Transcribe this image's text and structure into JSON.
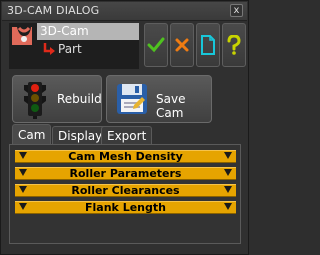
{
  "window": {
    "title": "3D-CAM DIALOG",
    "close_glyph": "x"
  },
  "tree": {
    "items": [
      {
        "label": "3D-Cam",
        "selected": true,
        "icon": "cam-profile-icon"
      },
      {
        "label": "Part",
        "selected": false,
        "icon": "red-arrow-icon"
      }
    ]
  },
  "top_buttons": [
    {
      "name": "accept-button",
      "icon": "green-check-icon",
      "color": "#4fc21f"
    },
    {
      "name": "cancel-button",
      "icon": "orange-x-icon",
      "color": "#f07c12"
    },
    {
      "name": "new-document-button",
      "icon": "new-document-icon",
      "color": "#18c7d9"
    },
    {
      "name": "help-button",
      "icon": "question-mark-icon",
      "color": "#c8d400"
    }
  ],
  "actions": {
    "rebuild_label": "Rebuild",
    "rebuild_icon": "traffic-light-icon",
    "save_label": "Save Cam",
    "save_icon": "floppy-disk-icon"
  },
  "tabs": [
    {
      "label": "Cam",
      "active": true
    },
    {
      "label": "Display",
      "active": false
    },
    {
      "label": "Export",
      "active": false
    }
  ],
  "sections": [
    {
      "title": "Cam Mesh Density",
      "expanded": false
    },
    {
      "title": "Roller Parameters",
      "expanded": false
    },
    {
      "title": "Roller Clearances",
      "expanded": false
    },
    {
      "title": "Flank Length",
      "expanded": false
    }
  ],
  "colors": {
    "section_bar": "#e6a400",
    "selection": "#b5b5b5",
    "background": "#303030"
  }
}
